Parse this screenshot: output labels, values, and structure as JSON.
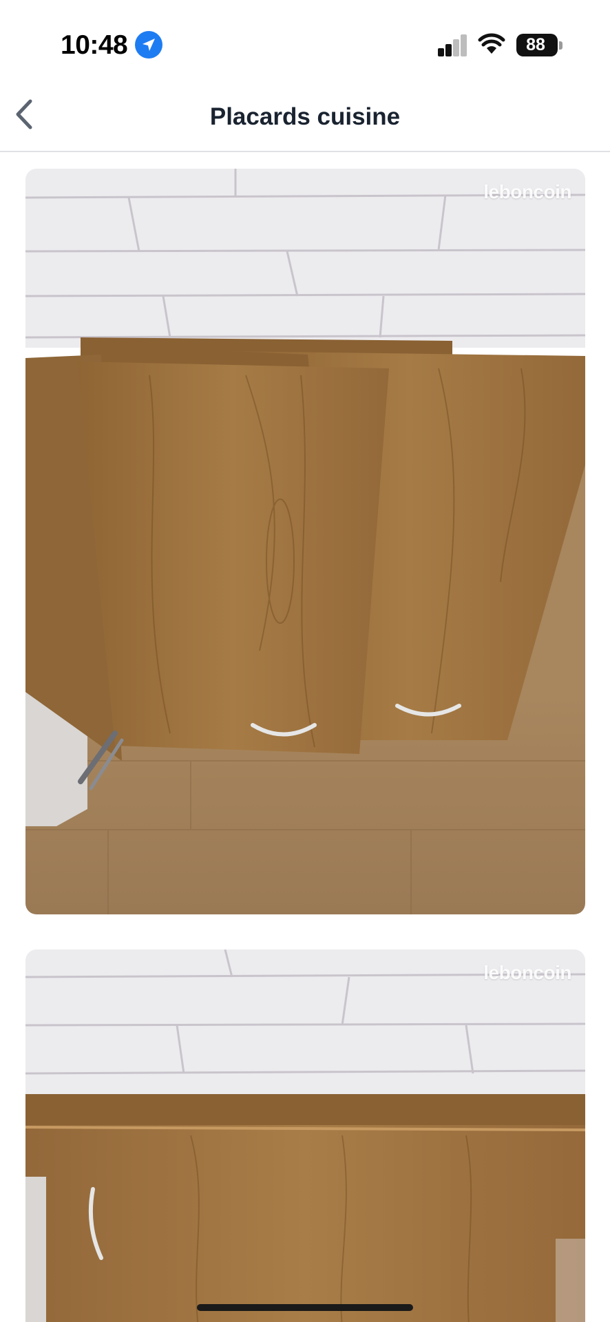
{
  "status_bar": {
    "time": "10:48",
    "battery": "88",
    "icons": [
      "location-arrow-icon",
      "cellular-signal-icon",
      "wifi-icon",
      "battery-icon"
    ]
  },
  "nav": {
    "title": "Placards cuisine",
    "back_icon": "chevron-left-icon"
  },
  "photos": [
    {
      "watermark": "leboncoin"
    },
    {
      "watermark": "leboncoin"
    }
  ],
  "colors": {
    "accent_blue": "#1e7cf2",
    "title_text": "#1a2330",
    "wood": "#9c7340",
    "wall": "#ecebee"
  }
}
